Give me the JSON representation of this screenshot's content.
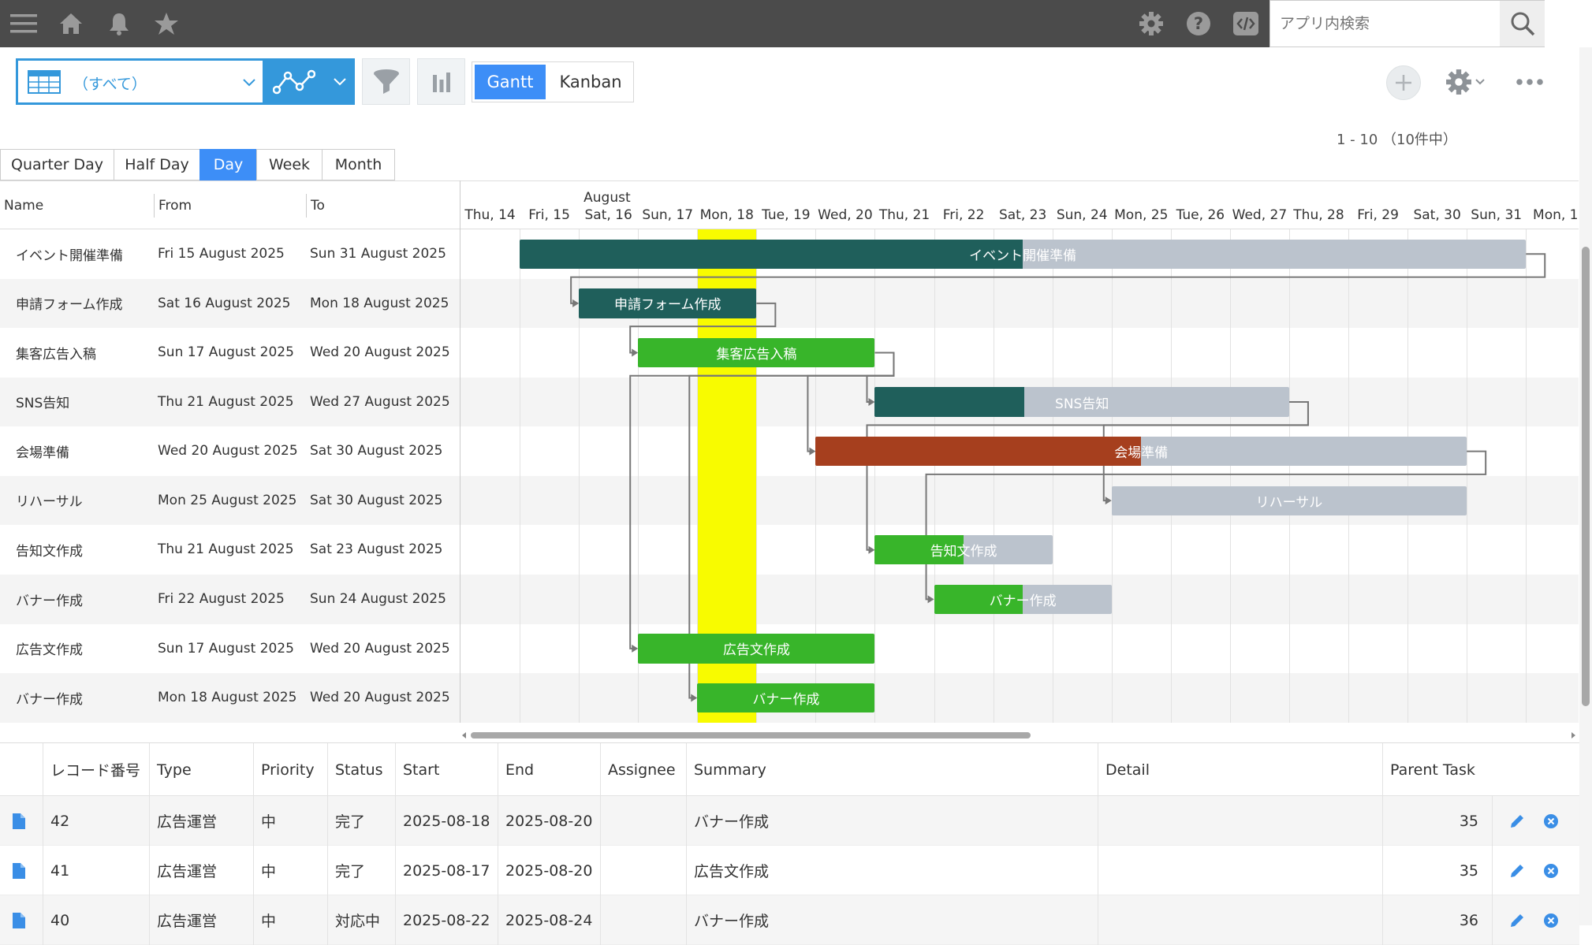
{
  "header": {
    "search_placeholder": "アプリ内検索",
    "icons": [
      "menu-icon",
      "home-icon",
      "bell-icon",
      "star-icon",
      "gear-icon",
      "help-icon",
      "code-icon",
      "search-icon"
    ]
  },
  "toolbar": {
    "view_select_label": "（すべて）",
    "view_gantt_label": "Gantt",
    "view_kanban_label": "Kanban",
    "pager": "1 - 10 （10件中）"
  },
  "scale_tabs": [
    {
      "label": "Quarter Day",
      "active": false
    },
    {
      "label": "Half Day",
      "active": false
    },
    {
      "label": "Day",
      "active": true
    },
    {
      "label": "Week",
      "active": false
    },
    {
      "label": "Month",
      "active": false
    }
  ],
  "gantt": {
    "columns": {
      "name": "Name",
      "from": "From",
      "to": "To"
    },
    "month_label": "August",
    "days": [
      "Thu, 14",
      "Fri, 15",
      "Sat, 16",
      "Sun, 17",
      "Mon, 18",
      "Tue, 19",
      "Wed, 20",
      "Thu, 21",
      "Fri, 22",
      "Sat, 23",
      "Sun, 24",
      "Mon, 25",
      "Tue, 26",
      "Wed, 27",
      "Thu, 28",
      "Fri, 29",
      "Sat, 30",
      "Sun, 31",
      "Mon, 1"
    ],
    "today_day": "Mon, 18",
    "tasks": [
      {
        "name": "イベント開催準備",
        "from": "Fri 15 August 2025",
        "to": "Sun 31 August 2025",
        "progress": 0.5,
        "color": "#1f5f5b"
      },
      {
        "name": "申請フォーム作成",
        "from": "Sat 16 August 2025",
        "to": "Mon 18 August 2025",
        "progress": 1.0,
        "color": "#1f5f5b"
      },
      {
        "name": "集客広告入稿",
        "from": "Sun 17 August 2025",
        "to": "Wed 20 August 2025",
        "progress": 1.0,
        "color": "#38b52a"
      },
      {
        "name": "SNS告知",
        "from": "Thu 21 August 2025",
        "to": "Wed 27 August 2025",
        "progress": 0.36,
        "color": "#1f5f5b"
      },
      {
        "name": "会場準備",
        "from": "Wed 20 August 2025",
        "to": "Sat 30 August 2025",
        "progress": 0.5,
        "color": "#a63f1e"
      },
      {
        "name": "リハーサル",
        "from": "Mon 25 August 2025",
        "to": "Sat 30 August 2025",
        "progress": 0.0,
        "color": "#bbc3cd"
      },
      {
        "name": "告知文作成",
        "from": "Thu 21 August 2025",
        "to": "Sat 23 August 2025",
        "progress": 0.5,
        "color": "#38b52a"
      },
      {
        "name": "バナー作成",
        "from": "Fri 22 August 2025",
        "to": "Sun 24 August 2025",
        "progress": 0.5,
        "color": "#38b52a"
      },
      {
        "name": "広告文作成",
        "from": "Sun 17 August 2025",
        "to": "Wed 20 August 2025",
        "progress": 1.0,
        "color": "#38b52a"
      },
      {
        "name": "バナー作成",
        "from": "Mon 18 August 2025",
        "to": "Wed 20 August 2025",
        "progress": 1.0,
        "color": "#38b52a"
      }
    ],
    "links": [
      {
        "from": 0,
        "to": 1
      },
      {
        "from": 1,
        "to": 2
      },
      {
        "from": 2,
        "to": 3
      },
      {
        "from": 2,
        "to": 4
      },
      {
        "from": 3,
        "to": 6
      },
      {
        "from": 3,
        "to": 5
      },
      {
        "from": 4,
        "to": 7
      },
      {
        "from": 2,
        "to": 8
      },
      {
        "from": 2,
        "to": 9
      }
    ]
  },
  "records": {
    "headers": [
      "レコード番号",
      "Type",
      "Priority",
      "Status",
      "Start",
      "End",
      "Assignee",
      "Summary",
      "Detail",
      "Parent Task"
    ],
    "rows": [
      {
        "id": "42",
        "type": "広告運営",
        "priority": "中",
        "status": "完了",
        "start": "2025-08-18",
        "end": "2025-08-20",
        "assignee": "",
        "summary": "バナー作成",
        "detail": "",
        "parent": "35"
      },
      {
        "id": "41",
        "type": "広告運営",
        "priority": "中",
        "status": "完了",
        "start": "2025-08-17",
        "end": "2025-08-20",
        "assignee": "",
        "summary": "広告文作成",
        "detail": "",
        "parent": "35"
      },
      {
        "id": "40",
        "type": "広告運営",
        "priority": "中",
        "status": "対応中",
        "start": "2025-08-22",
        "end": "2025-08-24",
        "assignee": "",
        "summary": "バナー作成",
        "detail": "",
        "parent": "36"
      }
    ]
  },
  "colors": {
    "accent": "#3d8ef7",
    "topbar": "#4b4b4b",
    "today": "#f8fb00",
    "remaining": "#bbc3cd"
  }
}
